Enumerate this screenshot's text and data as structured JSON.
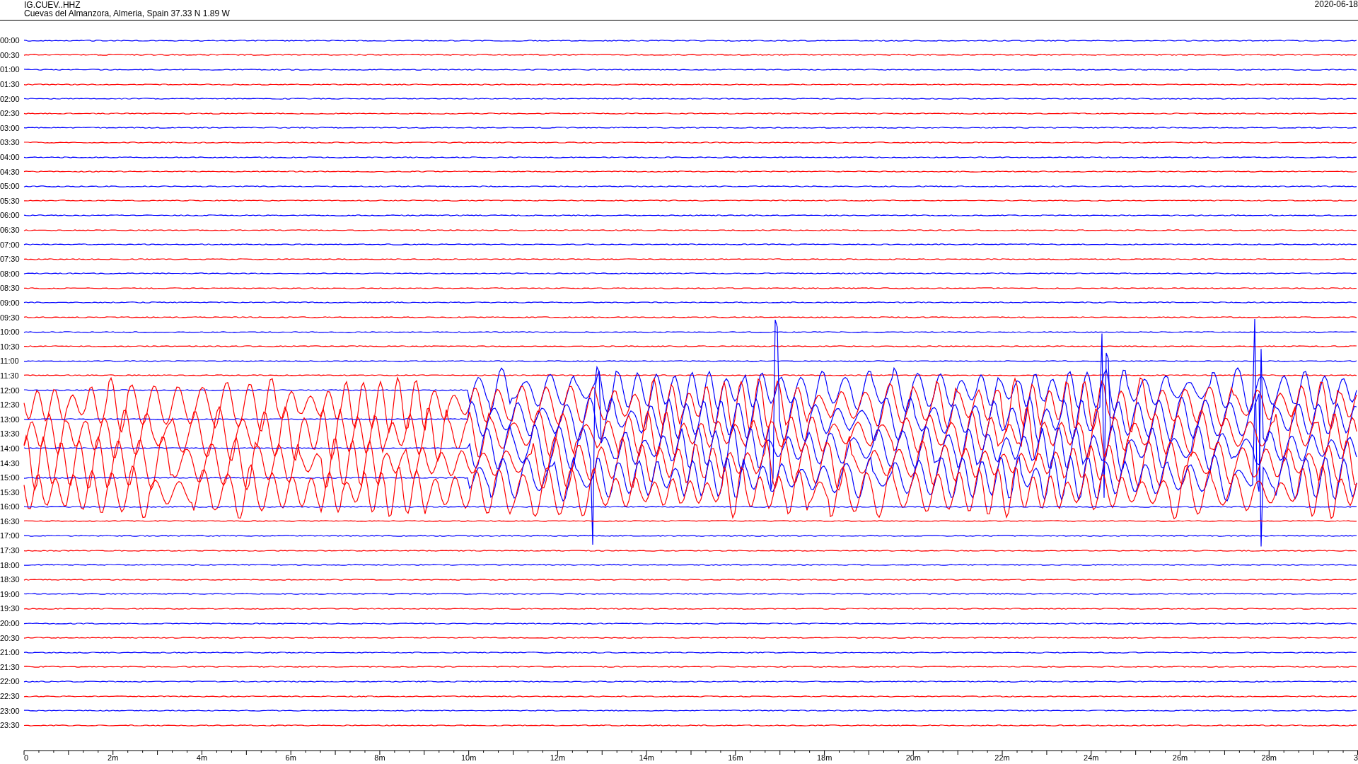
{
  "header": {
    "station": "IG.CUEV..HHZ",
    "location": "Cuevas del Almanzora, Almeria, Spain  37.33 N 1.89 W",
    "date": "2020-06-18"
  },
  "rows": [
    {
      "label": "00:00",
      "color": "#0000ff",
      "kind": "quiet"
    },
    {
      "label": "00:30",
      "color": "#ff0000",
      "kind": "quiet"
    },
    {
      "label": "01:00",
      "color": "#0000ff",
      "kind": "quiet"
    },
    {
      "label": "01:30",
      "color": "#ff0000",
      "kind": "quiet"
    },
    {
      "label": "02:00",
      "color": "#0000ff",
      "kind": "quiet"
    },
    {
      "label": "02:30",
      "color": "#ff0000",
      "kind": "quiet"
    },
    {
      "label": "03:00",
      "color": "#0000ff",
      "kind": "quiet"
    },
    {
      "label": "03:30",
      "color": "#ff0000",
      "kind": "quiet"
    },
    {
      "label": "04:00",
      "color": "#0000ff",
      "kind": "quiet"
    },
    {
      "label": "04:30",
      "color": "#ff0000",
      "kind": "quiet"
    },
    {
      "label": "05:00",
      "color": "#0000ff",
      "kind": "quiet"
    },
    {
      "label": "05:30",
      "color": "#ff0000",
      "kind": "quiet"
    },
    {
      "label": "06:00",
      "color": "#0000ff",
      "kind": "quiet"
    },
    {
      "label": "06:30",
      "color": "#ff0000",
      "kind": "quiet"
    },
    {
      "label": "07:00",
      "color": "#0000ff",
      "kind": "quiet"
    },
    {
      "label": "07:30",
      "color": "#ff0000",
      "kind": "quiet"
    },
    {
      "label": "08:00",
      "color": "#0000ff",
      "kind": "quiet"
    },
    {
      "label": "08:30",
      "color": "#ff0000",
      "kind": "quiet"
    },
    {
      "label": "09:00",
      "color": "#0000ff",
      "kind": "quiet"
    },
    {
      "label": "09:30",
      "color": "#ff0000",
      "kind": "quiet"
    },
    {
      "label": "10:00",
      "color": "#0000ff",
      "kind": "quiet"
    },
    {
      "label": "10:30",
      "color": "#ff0000",
      "kind": "quiet"
    },
    {
      "label": "11:00",
      "color": "#0000ff",
      "kind": "quiet"
    },
    {
      "label": "11:30",
      "color": "#ff0000",
      "kind": "quiet"
    },
    {
      "label": "12:00",
      "color": "#0000ff",
      "kind": "active_late"
    },
    {
      "label": "12:30",
      "color": "#ff0000",
      "kind": "active"
    },
    {
      "label": "13:00",
      "color": "#0000ff",
      "kind": "active_late"
    },
    {
      "label": "13:30",
      "color": "#ff0000",
      "kind": "active"
    },
    {
      "label": "14:00",
      "color": "#0000ff",
      "kind": "active_late"
    },
    {
      "label": "14:30",
      "color": "#ff0000",
      "kind": "active"
    },
    {
      "label": "15:00",
      "color": "#0000ff",
      "kind": "active_late"
    },
    {
      "label": "15:30",
      "color": "#ff0000",
      "kind": "active"
    },
    {
      "label": "16:00",
      "color": "#0000ff",
      "kind": "quiet"
    },
    {
      "label": "16:30",
      "color": "#ff0000",
      "kind": "quiet"
    },
    {
      "label": "17:00",
      "color": "#0000ff",
      "kind": "quiet"
    },
    {
      "label": "17:30",
      "color": "#ff0000",
      "kind": "quiet"
    },
    {
      "label": "18:00",
      "color": "#0000ff",
      "kind": "quiet"
    },
    {
      "label": "18:30",
      "color": "#ff0000",
      "kind": "quiet"
    },
    {
      "label": "19:00",
      "color": "#0000ff",
      "kind": "quiet"
    },
    {
      "label": "19:30",
      "color": "#ff0000",
      "kind": "quiet"
    },
    {
      "label": "20:00",
      "color": "#0000ff",
      "kind": "quiet"
    },
    {
      "label": "20:30",
      "color": "#ff0000",
      "kind": "quiet"
    },
    {
      "label": "21:00",
      "color": "#0000ff",
      "kind": "quiet"
    },
    {
      "label": "21:30",
      "color": "#ff0000",
      "kind": "quiet"
    },
    {
      "label": "22:00",
      "color": "#0000ff",
      "kind": "quiet"
    },
    {
      "label": "22:30",
      "color": "#ff0000",
      "kind": "quiet"
    },
    {
      "label": "23:00",
      "color": "#0000ff",
      "kind": "quiet"
    },
    {
      "label": "23:30",
      "color": "#ff0000",
      "kind": "quiet"
    }
  ],
  "time_axis": {
    "labels": [
      "0",
      "2m",
      "4m",
      "6m",
      "8m",
      "10m",
      "12m",
      "14m",
      "16m",
      "18m",
      "20m",
      "22m",
      "24m",
      "26m",
      "28m",
      "3"
    ]
  }
}
